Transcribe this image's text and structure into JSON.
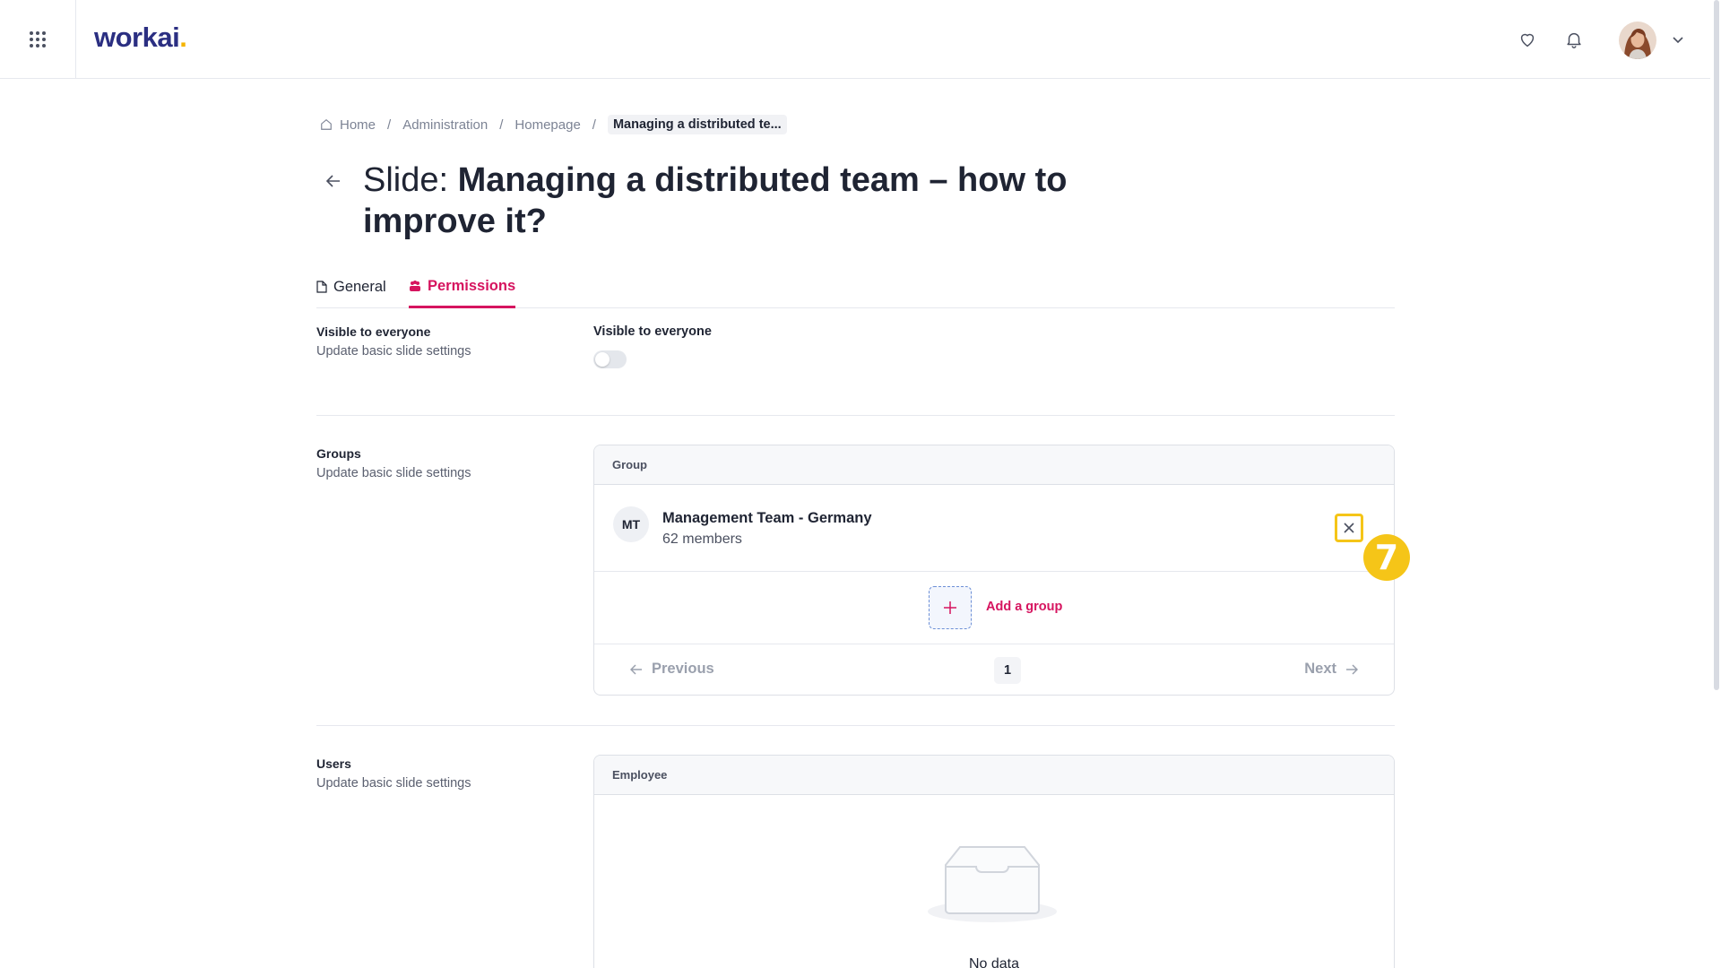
{
  "header": {
    "logo_text": "workai",
    "logo_dot": ".",
    "brand_color": "#2b2f82",
    "accent_color": "#f5b400",
    "icons": [
      "apps-grid-icon",
      "heart-icon",
      "bell-icon",
      "chevron-down-icon"
    ]
  },
  "breadcrumb": {
    "items": [
      "Home",
      "Administration",
      "Homepage"
    ],
    "separator": "/",
    "current": "Managing a distributed te..."
  },
  "title": {
    "prefix": "Slide: ",
    "name": "Managing a distributed team – how to improve it?"
  },
  "tabs": [
    {
      "label": "General",
      "active": false
    },
    {
      "label": "Permissions",
      "active": true
    }
  ],
  "active_color": "#d6145f",
  "visibility": {
    "section_title": "Visible to everyone",
    "section_subtitle": "Update basic slide settings",
    "toggle_label": "Visible to everyone",
    "toggle_on": false
  },
  "groups": {
    "section_title": "Groups",
    "section_subtitle": "Update basic slide settings",
    "column_header": "Group",
    "items": [
      {
        "initials": "MT",
        "name": "Management Team - Germany",
        "members": "62 members"
      }
    ],
    "add_label": "Add a group",
    "pagination": {
      "previous": "Previous",
      "page": "1",
      "next": "Next"
    },
    "step_marker": "7"
  },
  "users": {
    "section_title": "Users",
    "section_subtitle": "Update basic slide settings",
    "column_header": "Employee",
    "empty_text": "No data"
  }
}
